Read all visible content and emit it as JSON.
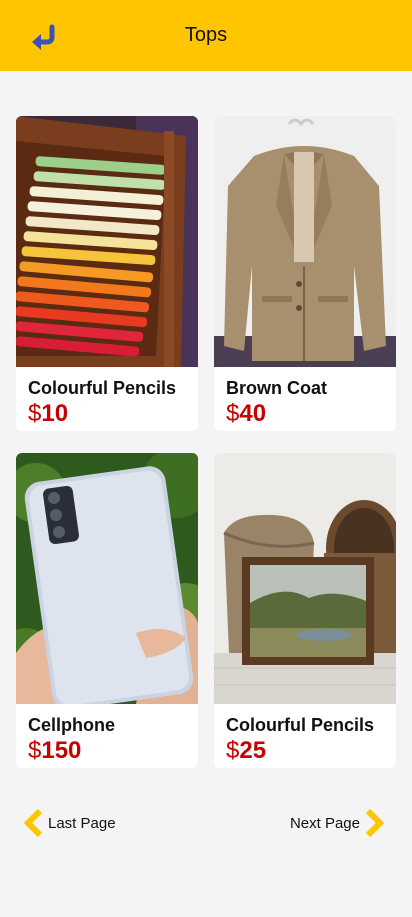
{
  "header": {
    "title": "Tops",
    "back_icon": "return-arrow-icon"
  },
  "colors": {
    "header_bg": "#ffc600",
    "price": "#c70000",
    "back_icon": "#3f51b5",
    "pager_arrow": "#ffc600"
  },
  "products": [
    {
      "name": "Colourful Pencils",
      "currency": "$",
      "amount": "10",
      "image": "colourful-pencils-photo"
    },
    {
      "name": "Brown Coat",
      "currency": "$",
      "amount": "40",
      "image": "brown-coat-photo"
    },
    {
      "name": "Cellphone",
      "currency": "$",
      "amount": "150",
      "image": "cellphone-photo"
    },
    {
      "name": "Colourful Pencils",
      "currency": "$",
      "amount": "25",
      "image": "framed-painting-photo"
    }
  ],
  "pagination": {
    "prev_label": "Last Page",
    "next_label": "Next Page"
  }
}
